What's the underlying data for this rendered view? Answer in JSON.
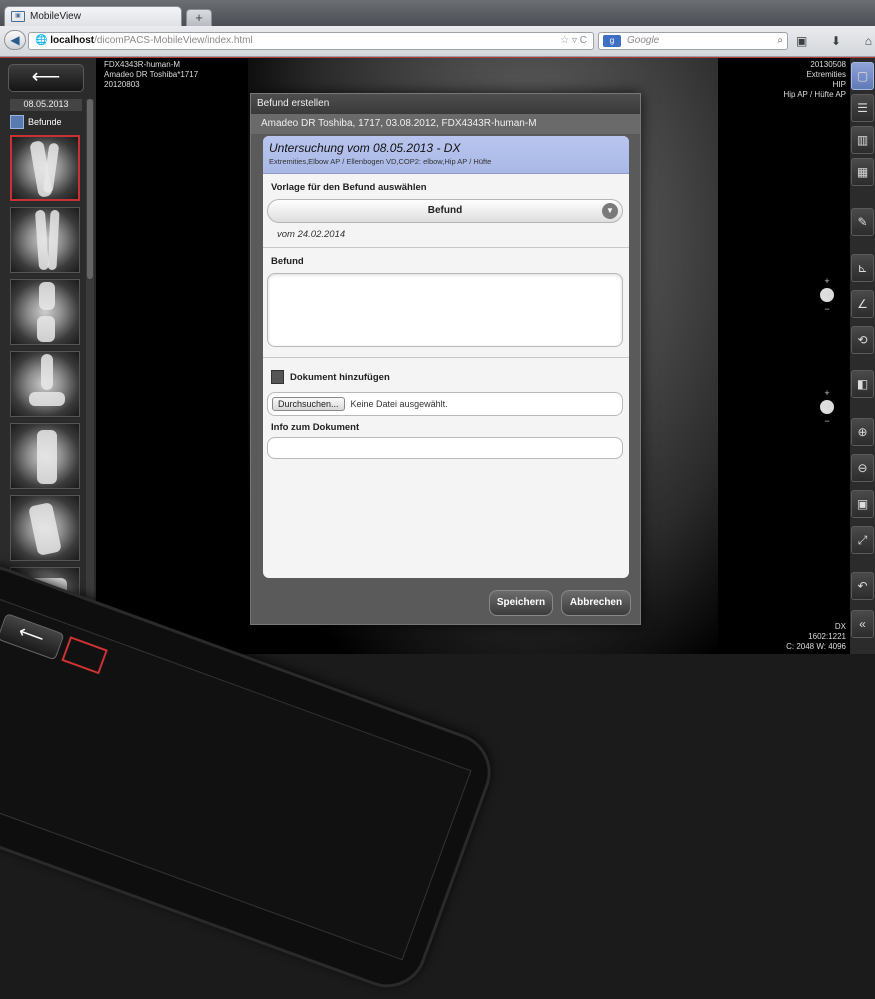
{
  "browser": {
    "tab_title": "MobileView",
    "new_tab": "+",
    "url_host": "localhost",
    "url_path": "/dicomPACS-MobileView/index.html",
    "search_placeholder": "Google"
  },
  "sidebar": {
    "back_label": "⟵",
    "date": "08.05.2013",
    "befunde_label": "Befunde"
  },
  "image_overlay": {
    "top_left": [
      "FDX4343R-human-M",
      "Amadeo DR Toshiba*1717",
      "20120803"
    ],
    "top_right": [
      "20130508",
      "Extremities",
      "HIP",
      "Hip AP / Hüfte AP"
    ],
    "bottom_right": [
      "DX",
      "1602:1221",
      "C: 2048 W: 4096"
    ]
  },
  "modal": {
    "title": "Befund erstellen",
    "subtitle": "Amadeo DR Toshiba, 1717, 03.08.2012, FDX4343R-human-M",
    "exam_title": "Untersuchung vom 08.05.2013 - DX",
    "exam_detail": "Extremities,Elbow AP / Ellenbogen VD,COP2: elbow,Hip AP / Hüfte",
    "template_label": "Vorlage für den Befund auswählen",
    "template_selected": "Befund",
    "template_date": "vom 24.02.2014",
    "befund_label": "Befund",
    "add_document_label": "Dokument hinzufügen",
    "browse_button": "Durchsuchen...",
    "no_file_text": "Keine Datei ausgewählt.",
    "info_label": "Info zum Dokument",
    "save_button": "Speichern",
    "cancel_button": "Abbrechen"
  },
  "toolbar_icons": [
    "layout-1x1-icon",
    "layout-2x1-icon",
    "layout-1x2-icon",
    "layout-2x2-icon",
    "annotate-icon",
    "measure-icon",
    "angle-icon",
    "rotate-icon",
    "invert-icon",
    "zoom-in-icon",
    "zoom-out-icon",
    "fit-icon",
    "fullscreen-icon",
    "undo-icon",
    "collapse-icon"
  ],
  "colors": {
    "modal_header": "#b3c0ec",
    "active_tool": "#7a8fcf",
    "selected_thumb_border": "#c83232"
  }
}
